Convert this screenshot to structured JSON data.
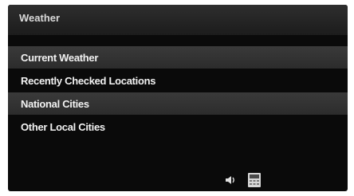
{
  "header": {
    "title": "Weather"
  },
  "menu": {
    "items": [
      {
        "label": "Current Weather"
      },
      {
        "label": "Recently Checked Locations"
      },
      {
        "label": "National Cities"
      },
      {
        "label": "Other Local Cities"
      }
    ]
  },
  "status": {
    "icons": [
      "speaker-icon",
      "phone-icon"
    ]
  },
  "colors": {
    "background": "#0a0a0a",
    "header": "#2a2a2a",
    "highlight_row": "#333333",
    "text": "#f2f2f2"
  }
}
